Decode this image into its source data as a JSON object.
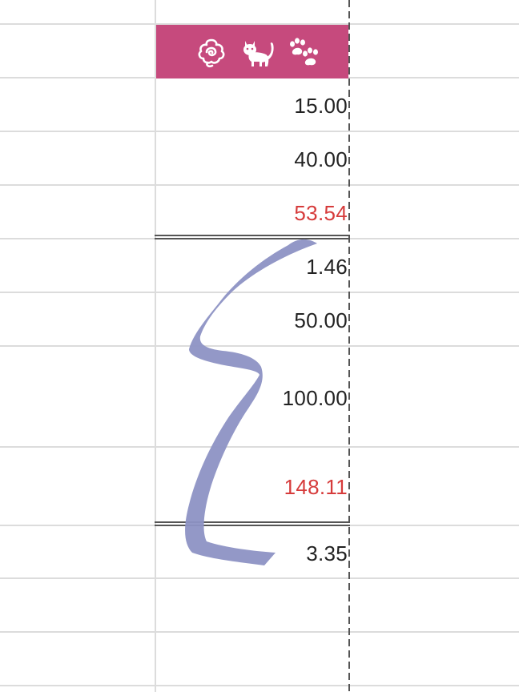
{
  "header": {
    "icons": [
      "rose-icon",
      "cat-icon",
      "paw-print-icon"
    ],
    "color": "#c64a7d"
  },
  "cells": [
    {
      "value": "15.00",
      "highlight": false
    },
    {
      "value": "40.00",
      "highlight": false
    },
    {
      "value": "53.54",
      "highlight": true
    },
    {
      "value": "1.46",
      "highlight": false
    },
    {
      "value": "50.00",
      "highlight": false
    },
    {
      "value": "100.00",
      "highlight": false
    },
    {
      "value": "148.11",
      "highlight": true
    },
    {
      "value": "3.35",
      "highlight": false
    }
  ],
  "colors": {
    "highlight_text": "#d63b3b",
    "annotation_stroke": "#8d92c4"
  }
}
